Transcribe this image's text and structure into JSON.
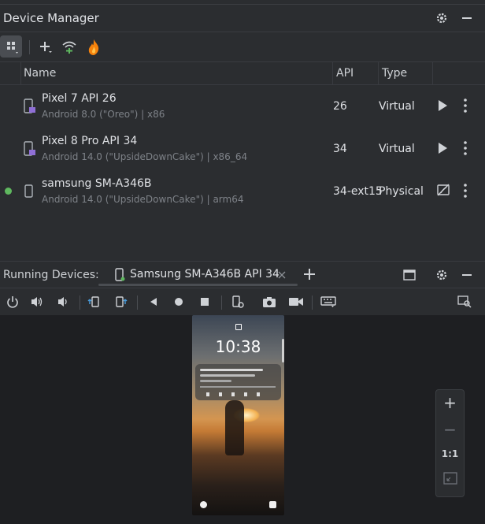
{
  "device_manager": {
    "title": "Device Manager",
    "columns": {
      "name": "Name",
      "api": "API",
      "type": "Type"
    },
    "devices": [
      {
        "name": "Pixel 7 API 26",
        "subtitle": "Android 8.0 (\"Oreo\") | x86",
        "api": "26",
        "type": "Virtual",
        "icon": "phone-virtual-icon"
      },
      {
        "name": "Pixel 8 Pro API 34",
        "subtitle": "Android 14.0 (\"UpsideDownCake\") | x86_64",
        "api": "34",
        "type": "Virtual",
        "icon": "phone-virtual-icon"
      },
      {
        "name": "samsung SM-A346B",
        "subtitle": "Android 14.0 (\"UpsideDownCake\") | arm64",
        "api": "34-ext15",
        "type": "Physical",
        "icon": "phone-physical-icon",
        "status": "online"
      }
    ]
  },
  "running_devices": {
    "label": "Running Devices:",
    "tab_title": "Samsung SM-A346B API 34"
  },
  "phone_screen": {
    "time": "10:38"
  },
  "zoom": {
    "plus": "+",
    "minus": "−",
    "one_to_one": "1:1"
  },
  "colors": {
    "panel_bg": "#2b2d30",
    "device_area_bg": "#1e1f22",
    "online_dot": "#5fb85f",
    "firebase_flame": "#f6820c"
  }
}
